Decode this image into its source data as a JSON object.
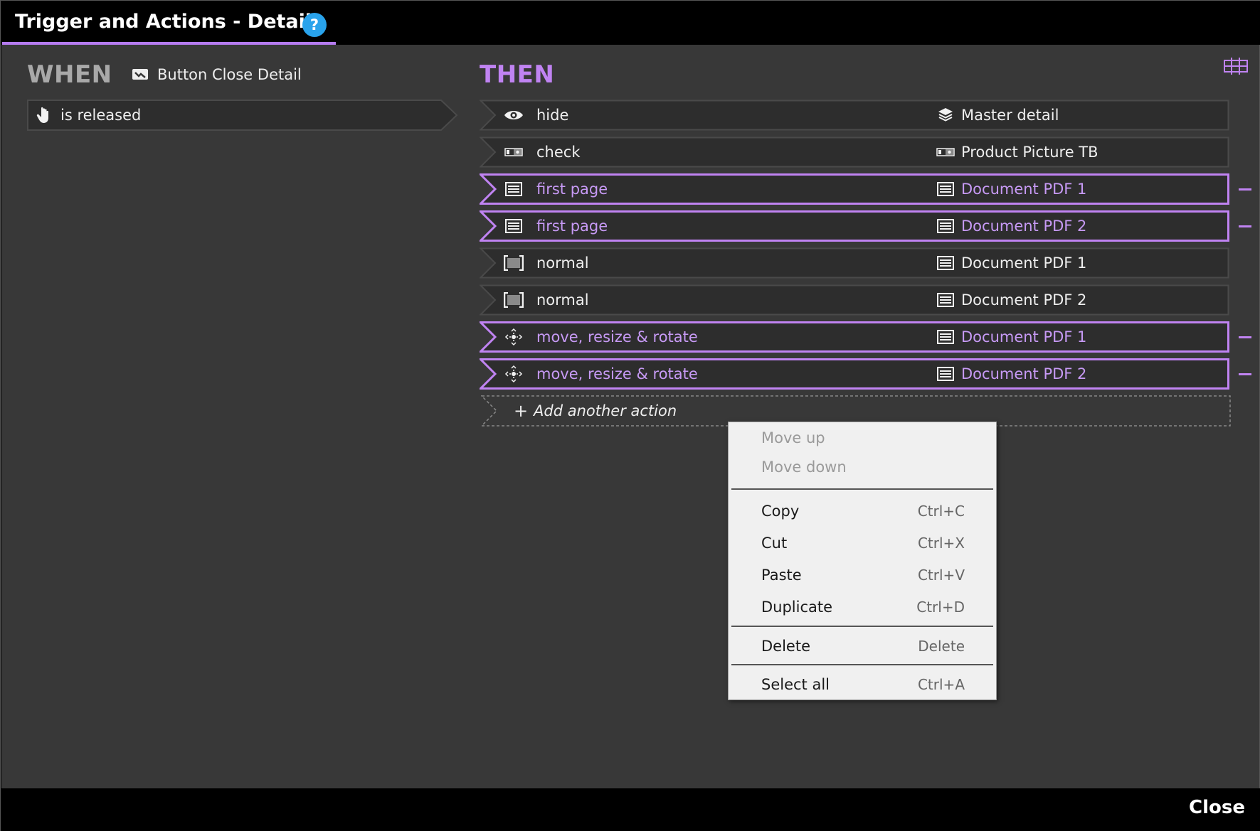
{
  "window": {
    "title": "Trigger and Actions - Details",
    "help_label": "?"
  },
  "when": {
    "heading": "WHEN",
    "source_name": "Button Close Detail",
    "source_icon": "button-icon",
    "trigger": {
      "label": "is released",
      "icon": "hand-pointer-icon"
    }
  },
  "then": {
    "heading": "THEN",
    "actions": [
      {
        "label": "hide",
        "icon": "eye-icon",
        "target": "Master detail",
        "target_icon": "layers-icon",
        "selected": false
      },
      {
        "label": "check",
        "icon": "toggle-icon",
        "target": "Product Picture TB",
        "target_icon": "toggle-icon",
        "selected": false
      },
      {
        "label": "first page",
        "icon": "document-icon",
        "target": "Document PDF 1",
        "target_icon": "document-icon",
        "selected": true
      },
      {
        "label": "first page",
        "icon": "document-icon",
        "target": "Document PDF 2",
        "target_icon": "document-icon",
        "selected": true
      },
      {
        "label": "normal",
        "icon": "fullscreen-icon",
        "target": "Document PDF 1",
        "target_icon": "document-icon",
        "selected": false
      },
      {
        "label": "normal",
        "icon": "fullscreen-icon",
        "target": "Document PDF 2",
        "target_icon": "document-icon",
        "selected": false
      },
      {
        "label": "move, resize & rotate",
        "icon": "move-icon",
        "target": "Document PDF 1",
        "target_icon": "document-icon",
        "selected": true
      },
      {
        "label": "move, resize & rotate",
        "icon": "move-icon",
        "target": "Document PDF 2",
        "target_icon": "document-icon",
        "selected": true
      }
    ],
    "add_action_label": "Add another action",
    "add_action_glyph": "+"
  },
  "context_menu": {
    "items": [
      {
        "label": "Move up",
        "shortcut": "",
        "enabled": false
      },
      {
        "label": "Move down",
        "shortcut": "",
        "enabled": false
      },
      {
        "label": "Copy",
        "shortcut": "Ctrl+C",
        "enabled": true
      },
      {
        "label": "Cut",
        "shortcut": "Ctrl+X",
        "enabled": true
      },
      {
        "label": "Paste",
        "shortcut": "Ctrl+V",
        "enabled": true
      },
      {
        "label": "Duplicate",
        "shortcut": "Ctrl+D",
        "enabled": true
      },
      {
        "label": "Delete",
        "shortcut": "Delete",
        "enabled": true
      },
      {
        "label": "Select all",
        "shortcut": "Ctrl+A",
        "enabled": true
      }
    ]
  },
  "footer": {
    "close_label": "Close"
  },
  "colors": {
    "accent": "#c083f2",
    "background": "#383838",
    "row": "#2d2d2d",
    "help": "#29a3ec"
  }
}
